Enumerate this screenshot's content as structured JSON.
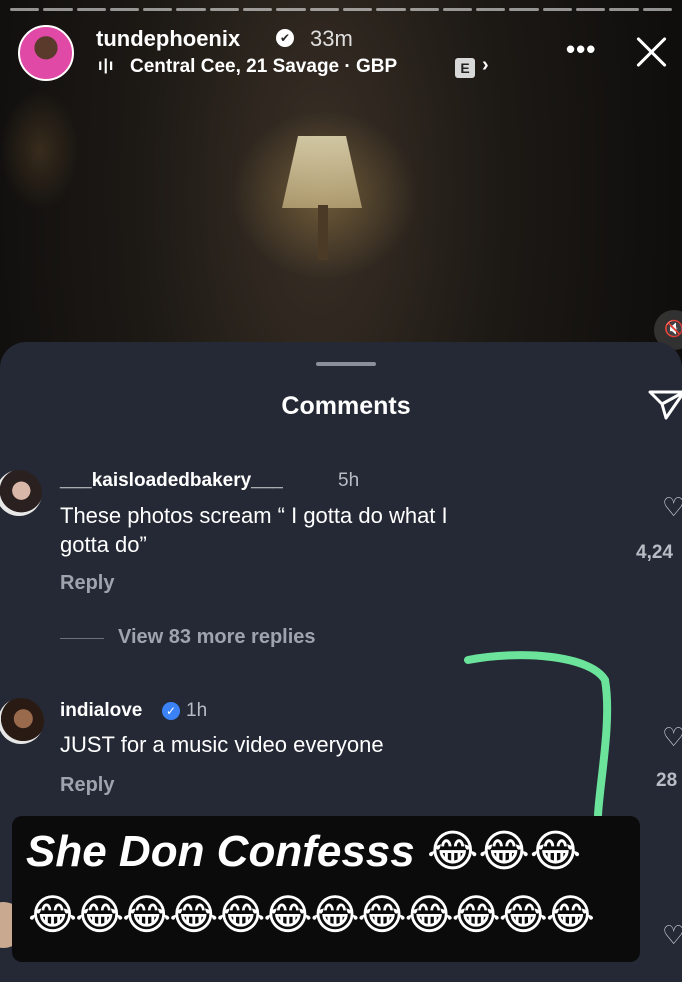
{
  "story": {
    "username": "tundephoenix",
    "verified_mark": "✔",
    "time_ago": "33m",
    "music_icon": "ı|ı",
    "music_label": "Central Cee, 21 Savage · GBP",
    "explicit_badge": "E",
    "chevron": "›",
    "more_glyph": "•••",
    "progress_segments": 20
  },
  "comments_sheet": {
    "title": "Comments",
    "comments": [
      {
        "username": "___kaisloadedbakery___",
        "time": "5h",
        "text_line1": "These photos scream “ I gotta do what I",
        "text_line2": "gotta do”",
        "reply_label": "Reply",
        "likes": "4,24",
        "view_more": "View 83 more replies"
      },
      {
        "username": "indialove",
        "verified_mark": "✓",
        "time": "1h",
        "text": "JUST for a music video everyone",
        "reply_label": "Reply",
        "likes": "28"
      }
    ]
  },
  "caption": {
    "line1": "She Don Confesss 😂😂😂",
    "line2": "😂😂😂😂😂😂😂😂😂😂😂😂"
  },
  "colors": {
    "sheet_bg": "#242935",
    "annotation_green": "#6be39a",
    "verified_blue": "#3b82f6"
  },
  "icons": [
    "more-icon",
    "close-icon",
    "mute-icon",
    "send-icon",
    "heart-icon",
    "verified-icon",
    "explicit-icon"
  ]
}
